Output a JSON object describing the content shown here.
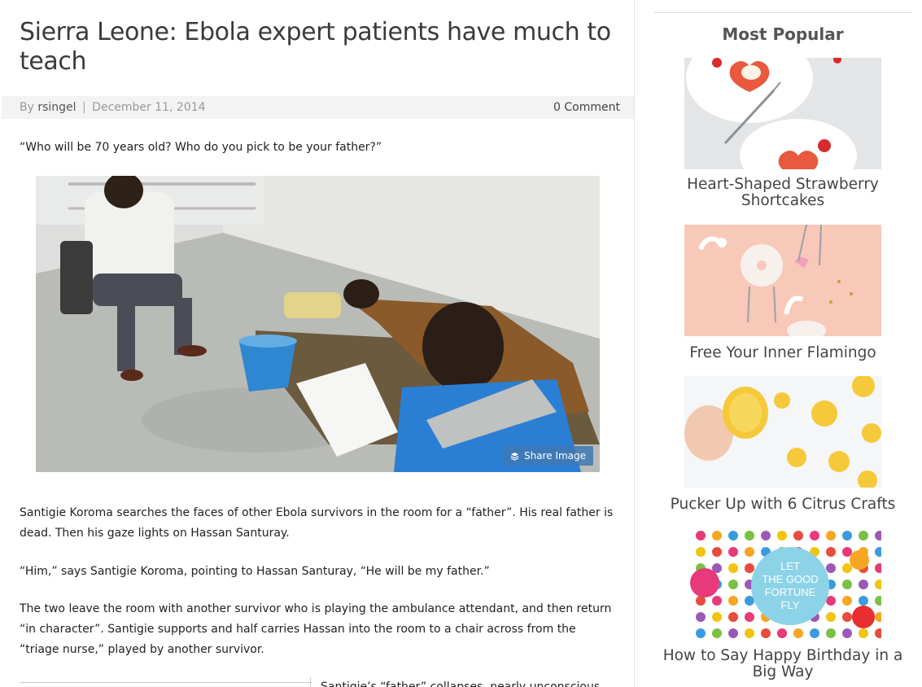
{
  "article": {
    "title": "Sierra Leone: Ebola expert patients have much to teach",
    "byline_prefix": "By",
    "author": "rsingel",
    "separator": "|",
    "date": "December 11, 2014",
    "comments": "0 Comment",
    "intro": "“Who will be 70 years old? Who do you pick to be your father?”",
    "share_label": "Share Image",
    "paragraphs": [
      "Santigie Koroma searches the faces of other Ebola survivors in the room for a “father”. His real father is dead. Then his gaze lights on Hassan Santuray.",
      "“Him,” says Santigie Koroma, pointing to Hassan Santuray, “He will be my father.”",
      "The two leave the room with another survivor who is playing the ambulance attendant, and then return “in character”. Santigie supports and half carries Hassan into the room to a chair across from the “triage nurse,” played by another survivor."
    ],
    "cutoff_text": "Santigie’s “father” collapses, nearly unconscious"
  },
  "sidebar": {
    "title": "Most Popular",
    "items": [
      {
        "title": "Heart-Shaped Strawberry Shortcakes"
      },
      {
        "title": "Free Your Inner Flamingo"
      },
      {
        "title": "Pucker Up with 6 Citrus Crafts"
      },
      {
        "title": "How to Say Happy Birthday in a Big Way",
        "badge_text": "LET THE GOOD FORTUNE FLY"
      }
    ]
  },
  "colors": {
    "share_button": "#4078b4",
    "meta_bar": "#f3f3f3",
    "flamingo_bg": "#f8c8b8"
  }
}
